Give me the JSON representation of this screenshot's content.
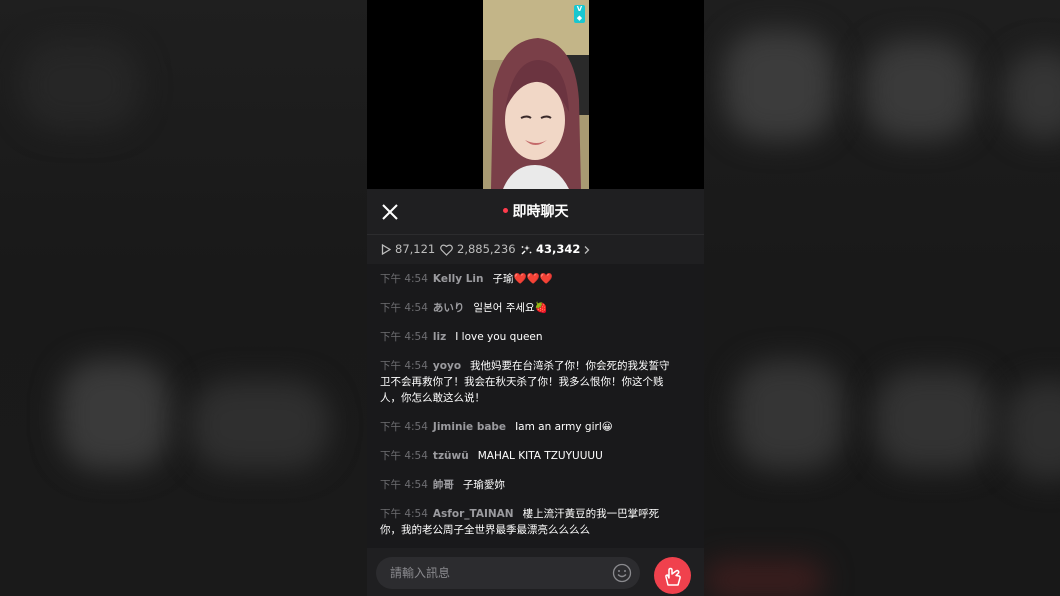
{
  "header": {
    "title": "即時聊天",
    "close_icon": "close-icon"
  },
  "stats": {
    "plays": "87,121",
    "likes": "2,885,236",
    "chats": "43,342"
  },
  "video": {
    "badge": "V LIVE"
  },
  "messages": [
    {
      "time": "下午 4:54",
      "user": "Kelly Lin",
      "text": "子瑜❤️❤️❤️"
    },
    {
      "time": "下午 4:54",
      "user": "あいり",
      "text": "일본어 주세요🍓"
    },
    {
      "time": "下午 4:54",
      "user": "liz",
      "text": "I love you queen"
    },
    {
      "time": "下午 4:54",
      "user": "yoyo",
      "text": "我他妈要在台湾杀了你！你会死的我发誓守卫不会再救你了！我会在秋天杀了你！我多么恨你！你这个贱人，你怎么敢这么说！"
    },
    {
      "time": "下午 4:54",
      "user": "Jiminie babe",
      "text": "Iam an army girl😀"
    },
    {
      "time": "下午 4:54",
      "user": "tzüwü",
      "text": "MAHAL KITA TZUYUUUU"
    },
    {
      "time": "下午 4:54",
      "user": "帥哥",
      "text": "子瑜愛妳"
    },
    {
      "time": "下午 4:54",
      "user": "Asfor_TAINAN",
      "text": "樓上流汗黃豆的我一巴掌呼死你，我的老公周子全世界最季最漂亮么么么么"
    }
  ],
  "input": {
    "placeholder": "請輸入訊息"
  },
  "colors": {
    "accent": "#f0414d",
    "live_dot": "#ff3b4c",
    "background": "#1e1e20"
  }
}
